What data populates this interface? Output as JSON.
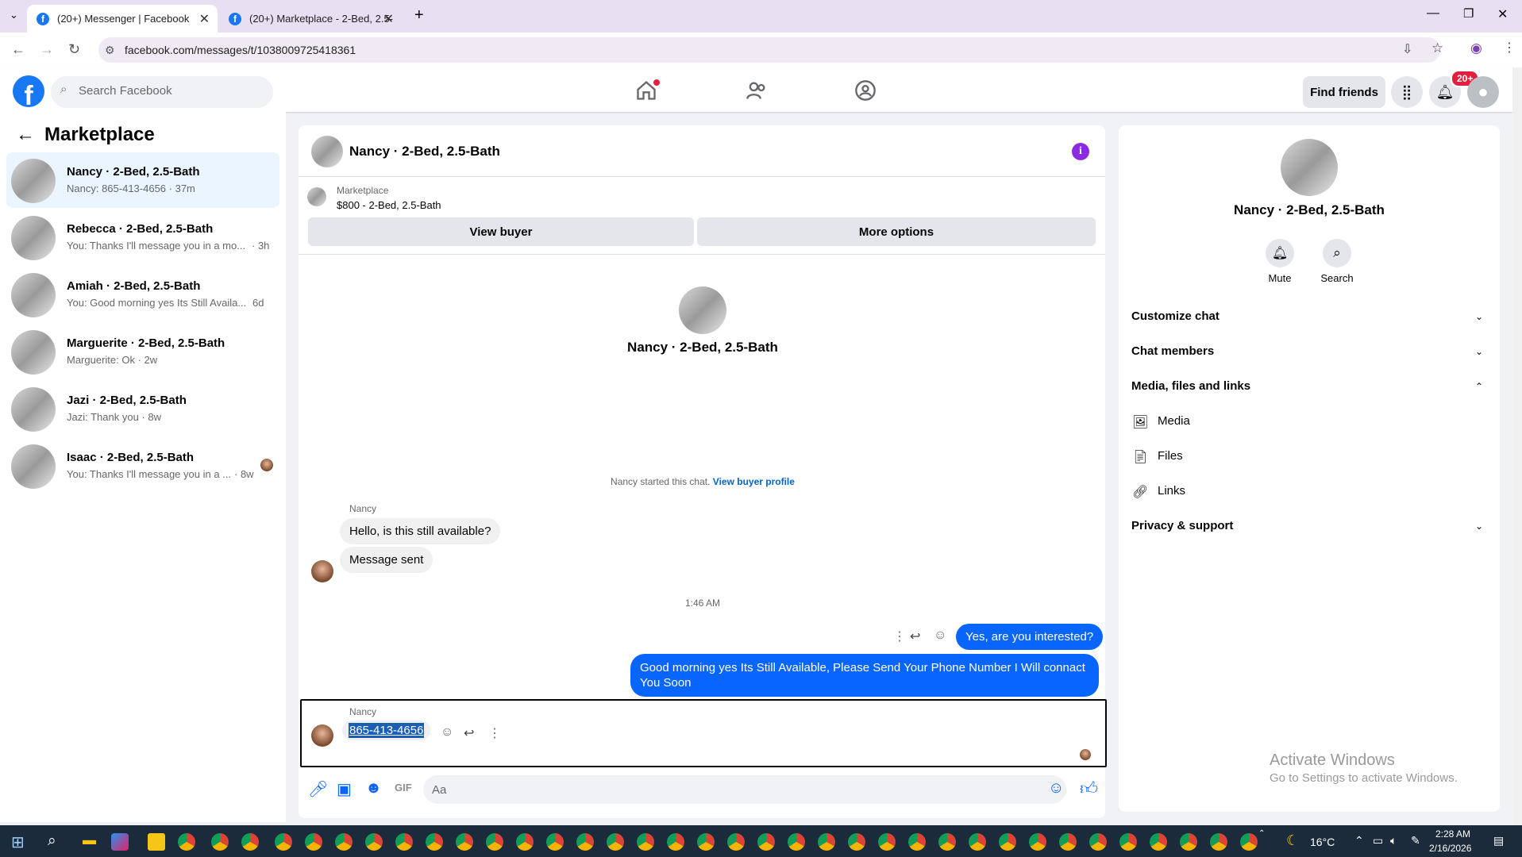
{
  "browser": {
    "tabs": [
      {
        "title": "(20+) Messenger | Facebook",
        "active": true
      },
      {
        "title": "(20+) Marketplace - 2-Bed, 2.5-",
        "active": false
      }
    ],
    "url": "facebook.com/messages/t/1038009725418361"
  },
  "fb_header": {
    "search_placeholder": "Search Facebook",
    "find_friends": "Find friends",
    "notification_badge": "20+"
  },
  "left_panel": {
    "title": "Marketplace",
    "conversations": [
      {
        "name": "Nancy · 2-Bed, 2.5-Bath",
        "snippet": "Nancy: 865-413-4656 · 37m",
        "time": "",
        "active": true
      },
      {
        "name": "Rebecca · 2-Bed, 2.5-Bath",
        "snippet": "You: Thanks I'll message you in a mo...",
        "time": "· 3h",
        "active": false
      },
      {
        "name": "Amiah · 2-Bed, 2.5-Bath",
        "snippet": "You: Good morning yes Its Still Availa...",
        "time": "6d",
        "active": false
      },
      {
        "name": "Marguerite · 2-Bed, 2.5-Bath",
        "snippet": "Marguerite: Ok · 2w",
        "time": "",
        "active": false
      },
      {
        "name": "Jazi · 2-Bed, 2.5-Bath",
        "snippet": "Jazi: Thank you · 8w",
        "time": "",
        "active": false
      },
      {
        "name": "Isaac · 2-Bed, 2.5-Bath",
        "snippet": "You: Thanks I'll message you in a ...",
        "time": "· 8w",
        "active": false
      }
    ]
  },
  "chat": {
    "title": "Nancy · 2-Bed, 2.5-Bath",
    "marketplace_label": "Marketplace",
    "listing": "$800 - 2-Bed, 2.5-Bath",
    "view_buyer": "View buyer",
    "more_options": "More options",
    "intro_name": "Nancy · 2-Bed, 2.5-Bath",
    "started_text": "Nancy started this chat.",
    "view_buyer_profile": "View buyer profile",
    "sender_name_1": "Nancy",
    "msg_in_1": "Hello, is this still available?",
    "msg_in_2": "Message sent",
    "timestamp": "1:46 AM",
    "msg_out_1": "Yes, are you interested?",
    "msg_out_2": "Good morning yes  Its Still Available, Please Send Your Phone Number I Will connact You Soon",
    "sender_name_2": "Nancy",
    "msg_phone": "865-413-4656",
    "composer_placeholder": "Aa"
  },
  "right_panel": {
    "title": "Nancy · 2-Bed, 2.5-Bath",
    "mute": "Mute",
    "search": "Search",
    "customize_chat": "Customize chat",
    "chat_members": "Chat members",
    "media_files_links": "Media, files and links",
    "media": "Media",
    "files": "Files",
    "links": "Links",
    "privacy_support": "Privacy & support"
  },
  "watermark": {
    "line1": "Activate Windows",
    "line2": "Go to Settings to activate Windows."
  },
  "taskbar": {
    "temperature": "16°C",
    "time": "2:28 AM",
    "date": "2/16/2026"
  },
  "colors": {
    "fb_blue": "#1877f2",
    "messenger_blue": "#0866ff",
    "badge_red": "#e41e3f",
    "info_purple": "#8a2be2"
  }
}
